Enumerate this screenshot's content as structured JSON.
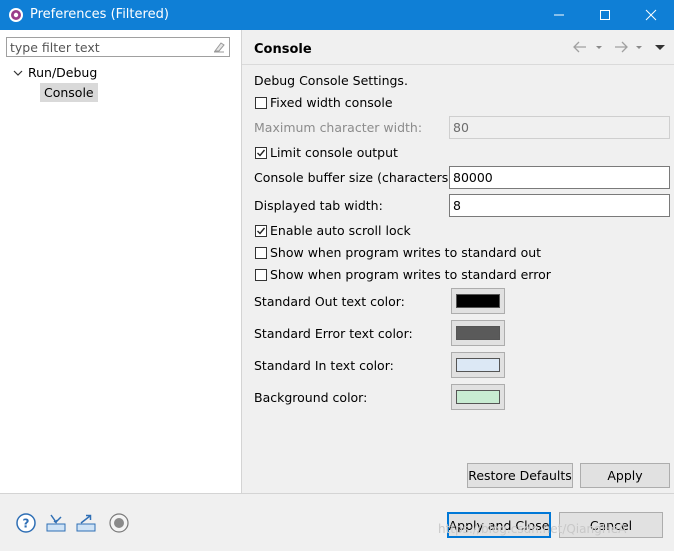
{
  "window": {
    "title": "Preferences (Filtered)",
    "titlebar_color": "#0f7fd6"
  },
  "left": {
    "filter_placeholder": "type filter text",
    "tree": {
      "parent": "Run/Debug",
      "child": "Console"
    }
  },
  "page": {
    "title": "Console",
    "heading": "Debug Console Settings.",
    "fixed_width_label": "Fixed width console",
    "fixed_width_checked": false,
    "max_char_width_label": "Maximum character width:",
    "max_char_width_value": "80",
    "limit_output_label": "Limit console output",
    "limit_output_checked": true,
    "buffer_size_label": "Console buffer size (characters):",
    "buffer_size_value": "80000",
    "tab_width_label": "Displayed tab width:",
    "tab_width_value": "8",
    "auto_scroll_label": "Enable auto scroll lock",
    "auto_scroll_checked": true,
    "show_out_label": "Show when program writes to standard out",
    "show_out_checked": false,
    "show_err_label": "Show when program writes to standard error",
    "show_err_checked": false,
    "colors": {
      "std_out_label": "Standard Out text color:",
      "std_out_color": "#000000",
      "std_err_label": "Standard Error text color:",
      "std_err_color": "#5a5a5a",
      "std_in_label": "Standard In text color:",
      "std_in_color": "#dce8f5",
      "background_label": "Background color:",
      "background_color": "#c8ecd2"
    },
    "restore_defaults_label": "Restore Defaults",
    "apply_label": "Apply"
  },
  "footer": {
    "apply_close_label": "Apply and Close",
    "cancel_label": "Cancel",
    "watermark": "https://blog.csdn.net/QiangHeA"
  }
}
